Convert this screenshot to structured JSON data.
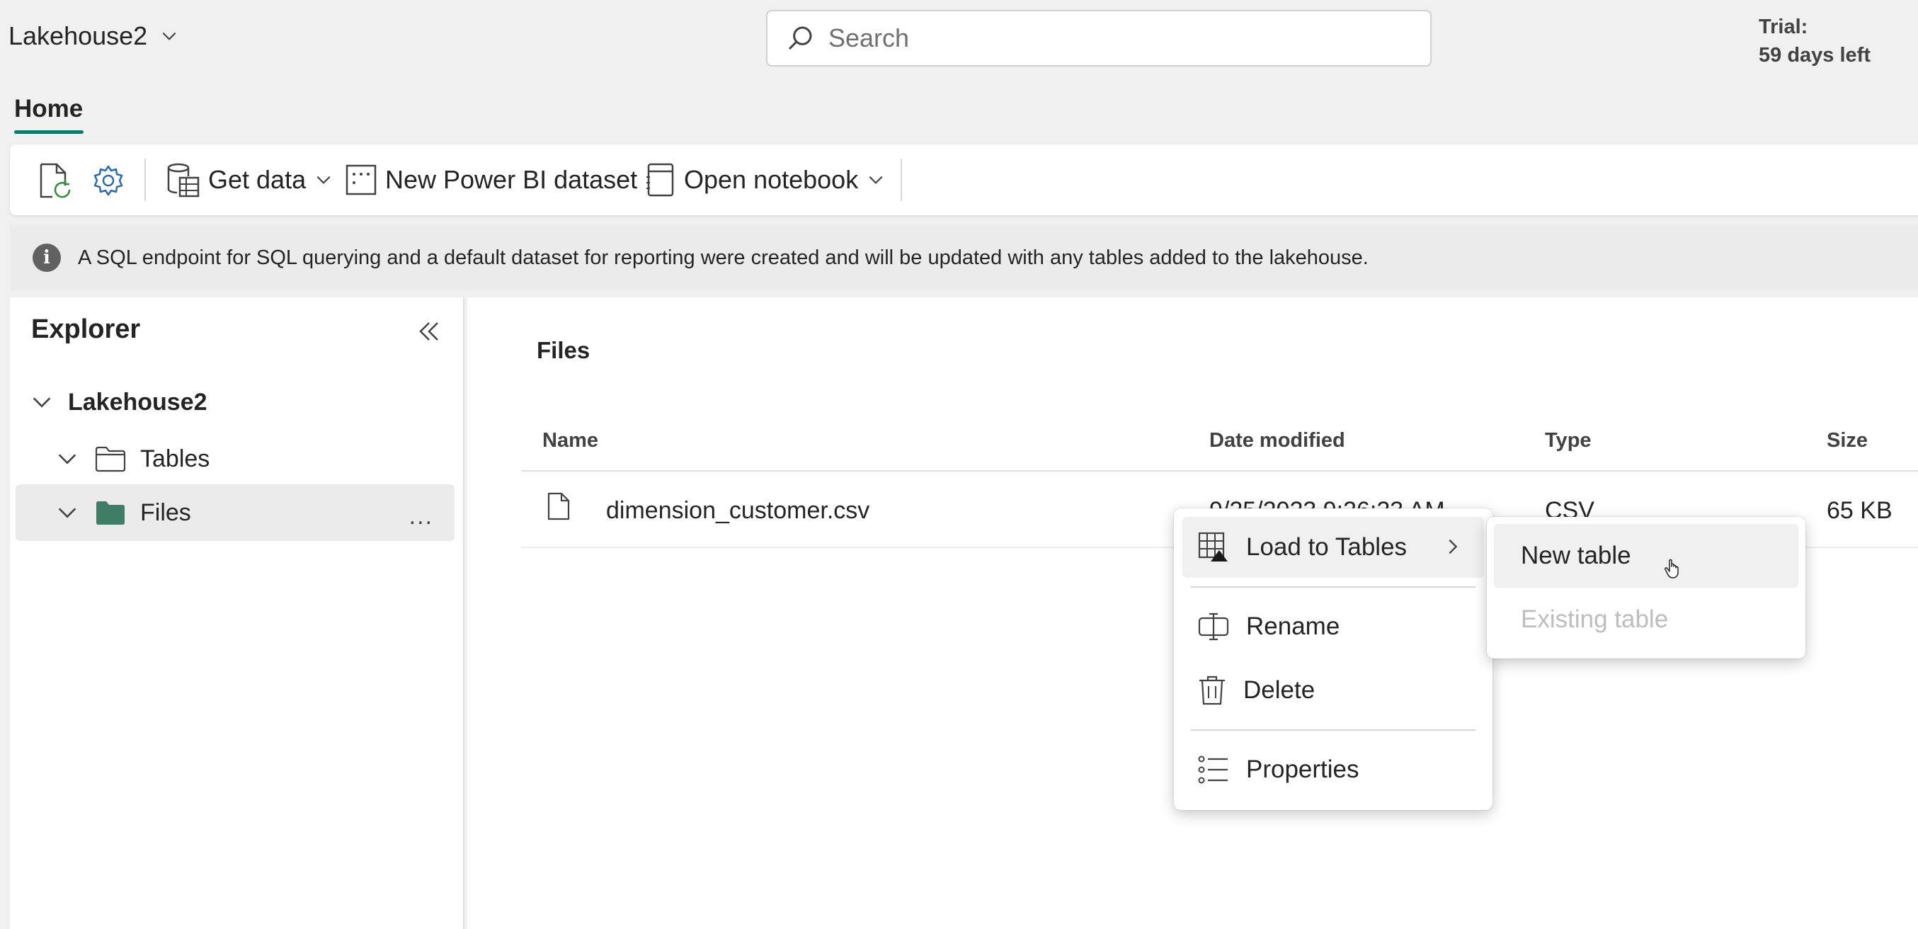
{
  "header": {
    "workspace_name": "Lakehouse2",
    "search_placeholder": "Search",
    "trial_line1": "Trial:",
    "trial_line2": "59 days left"
  },
  "tabs": {
    "home_label": "Home"
  },
  "ribbon": {
    "get_data_label": "Get data",
    "new_dataset_label": "New Power BI dataset",
    "open_notebook_label": "Open notebook"
  },
  "info_bar": {
    "message": "A SQL endpoint for SQL querying and a default dataset for reporting were created and will be updated with any tables added to the lakehouse."
  },
  "explorer": {
    "title": "Explorer",
    "tree": {
      "root": "Lakehouse2",
      "tables": "Tables",
      "files": "Files",
      "files_more": "..."
    }
  },
  "content": {
    "title": "Files",
    "columns": {
      "name": "Name",
      "date_modified": "Date modified",
      "type": "Type",
      "size": "Size"
    },
    "rows": [
      {
        "name": "dimension_customer.csv",
        "date_modified": "9/25/2023 9:26:23 AM",
        "type": "CSV",
        "size": "65 KB"
      }
    ]
  },
  "context_menu": {
    "items": [
      {
        "label": "Load to Tables",
        "icon": "table-load-icon"
      },
      {
        "label": "Rename",
        "icon": "rename-icon"
      },
      {
        "label": "Delete",
        "icon": "trash-icon"
      },
      {
        "label": "Properties",
        "icon": "properties-icon"
      }
    ]
  },
  "submenu": {
    "new_table": "New table",
    "existing_table": "Existing table"
  },
  "colors": {
    "accent": "#117865",
    "folder_files": "#3f7d66",
    "background": "#f0f0f0"
  }
}
